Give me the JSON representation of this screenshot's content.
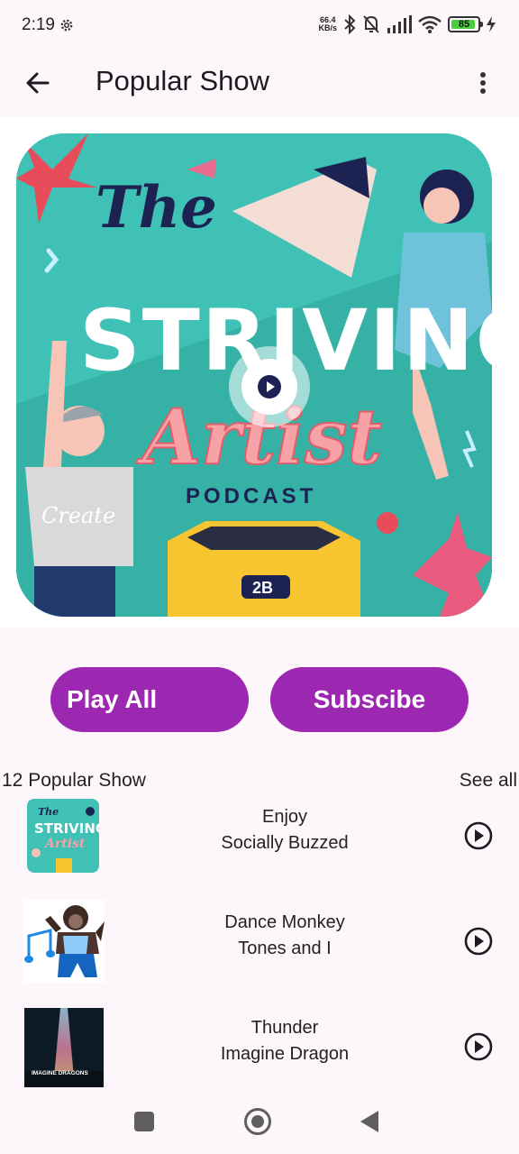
{
  "status_bar": {
    "time": "2:19",
    "net_speed_value": "66.4",
    "net_speed_unit": "KB/s",
    "battery_level": "85",
    "icons": [
      "gear-icon",
      "bluetooth-icon",
      "notifications-off-icon",
      "signal-icon",
      "wifi-icon",
      "battery-icon",
      "charging-icon"
    ]
  },
  "app_bar": {
    "title": "Popular Show",
    "back_icon": "arrow-left-icon",
    "menu_icon": "more-vertical-icon"
  },
  "cover": {
    "text_line1": "The",
    "text_line2": "STRIVING",
    "text_line3": "Artist",
    "text_line4": "PODCAST",
    "shirt_text": "Create",
    "box_label": "2B",
    "play_icon": "play-icon"
  },
  "actions": {
    "play_all_label": "Play All",
    "subscribe_label": "Subscibe",
    "accent_color": "#9c27b0"
  },
  "list": {
    "title": "12 Popular Show",
    "see_all_label": "See all",
    "items": [
      {
        "title": "Enjoy",
        "artist": "Socially Buzzed",
        "thumb": "striving-artist-cover"
      },
      {
        "title": "Dance Monkey",
        "artist": "Tones and I",
        "thumb": "dancing-gorilla"
      },
      {
        "title": "Thunder",
        "artist": "Imagine Dragon",
        "thumb": "evolve-album",
        "thumb_text": "IMAGINE DRAGONS"
      }
    ]
  },
  "nav_bar": {
    "icons": [
      "recents-square-icon",
      "home-circle-icon",
      "back-triangle-icon"
    ]
  }
}
